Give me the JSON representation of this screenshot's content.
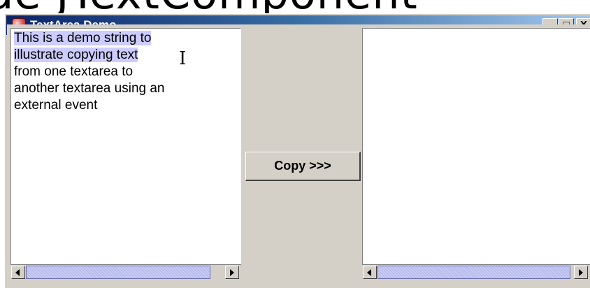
{
  "background_text": "de JTextComponent",
  "window": {
    "title": "TextArea Demo",
    "controls": {
      "minimize": "_",
      "maximize": "□",
      "close": "X"
    }
  },
  "left_textarea": {
    "lines": [
      "This is a demo string to",
      "illustrate copying text",
      "from one textarea to",
      "another textarea using an",
      "external event"
    ],
    "selected_lines": 2
  },
  "copy_button": {
    "label": "Copy >>>"
  },
  "right_textarea": {
    "lines": []
  },
  "colors": {
    "selection": "#ccccff",
    "titlebar_start": "#0a246a",
    "titlebar_end": "#a6caf0",
    "window_bg": "#d4d0c8",
    "scroll_track": "#b8bcee"
  }
}
